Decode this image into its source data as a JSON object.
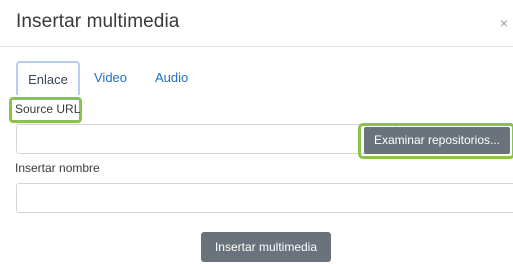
{
  "dialog": {
    "title": "Insertar multimedia",
    "close_symbol": "×"
  },
  "tabs": [
    {
      "label": "Enlace",
      "active": true
    },
    {
      "label": "Video",
      "active": false
    },
    {
      "label": "Audio",
      "active": false
    }
  ],
  "form": {
    "source_url_label": "Source URL",
    "source_url_value": "",
    "browse_button_label": "Examinar repositorios...",
    "name_label": "Insertar nombre",
    "name_value": "",
    "submit_button_label": "Insertar multimedia"
  },
  "colors": {
    "highlight": "#8bc34a",
    "button": "#6a737b",
    "link": "#1f6fc5",
    "active_tab_border": "#b9cdf2"
  }
}
